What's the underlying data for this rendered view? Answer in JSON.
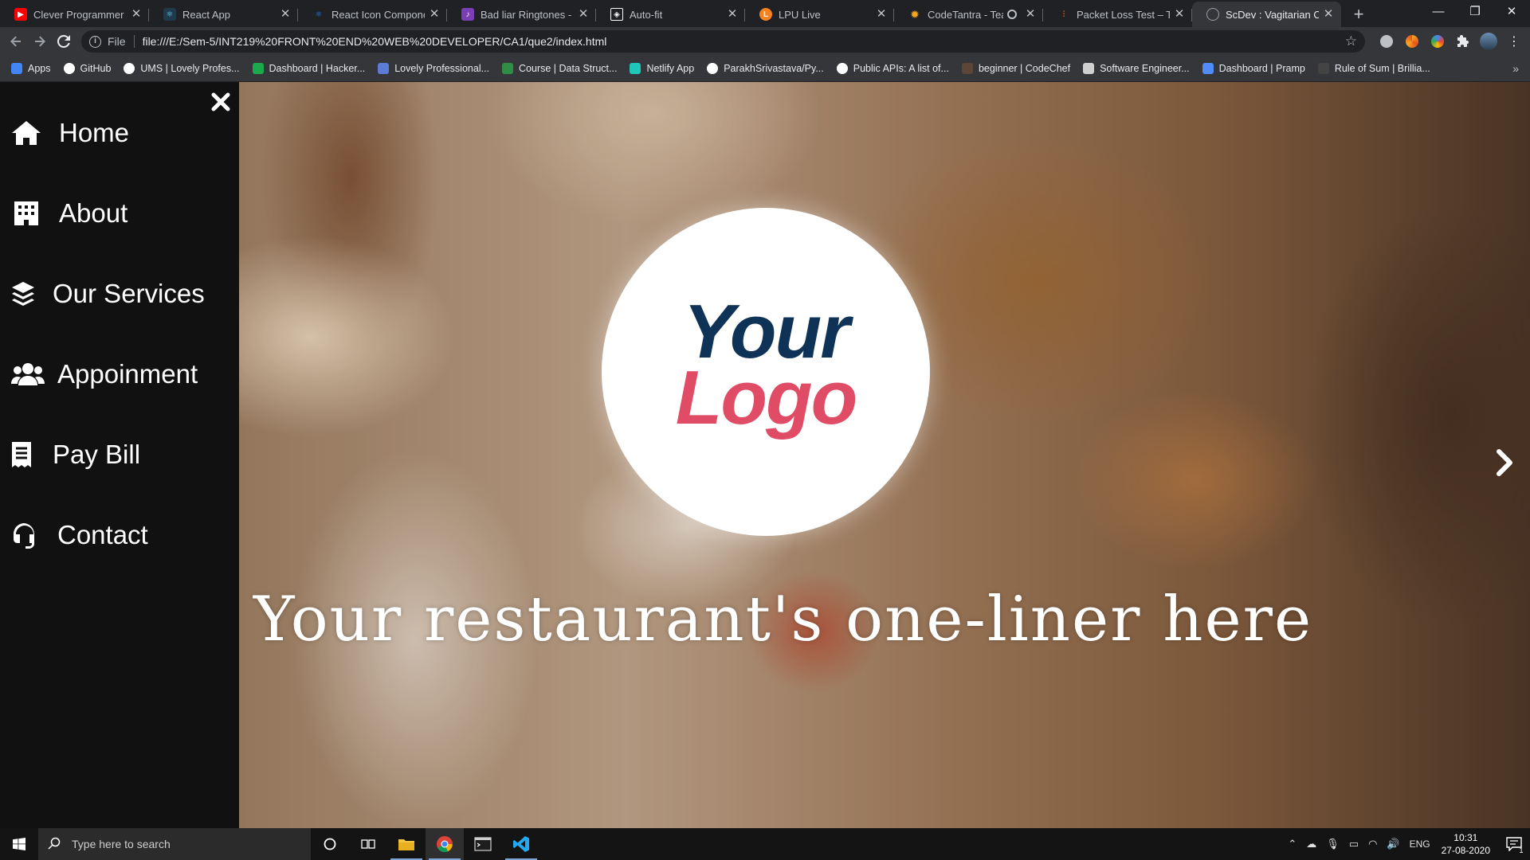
{
  "browser": {
    "tabs": [
      {
        "title": "Clever Programmer - Yo",
        "icon": "youtube-icon",
        "color": "#ff0000"
      },
      {
        "title": "React App",
        "icon": "react-icon",
        "color": "#61dafb"
      },
      {
        "title": "React Icon Component",
        "icon": "react-icons-icon",
        "color": "#2f80ed"
      },
      {
        "title": "Bad liar Ringtones - Fre",
        "icon": "ringtone-icon",
        "color": "#7b3fb5"
      },
      {
        "title": "Auto-fit",
        "icon": "codepen-icon",
        "color": "#ffffff"
      },
      {
        "title": "LPU Live",
        "icon": "lpu-icon",
        "color": "#f58220"
      },
      {
        "title": "CodeTantra - Teach",
        "icon": "codetantra-icon",
        "color": "#f5a623"
      },
      {
        "title": "Packet Loss Test – Test",
        "icon": "packet-loss-icon",
        "color": "#e8501c"
      },
      {
        "title": "ScDev : Vagitarian Caffe",
        "icon": "globe-icon",
        "color": "#9aa0a6"
      }
    ],
    "active_tab_index": 8,
    "address": {
      "scheme": "File",
      "url": "file:///E:/Sem-5/INT219%20FRONT%20END%20WEB%20DEVELOPER/CA1/que2/index.html"
    },
    "bookmarks": [
      {
        "label": "Apps",
        "color": "#4285f4"
      },
      {
        "label": "GitHub",
        "color": "#ffffff"
      },
      {
        "label": "UMS | Lovely Profes...",
        "color": "#ffffff"
      },
      {
        "label": "Dashboard | Hacker...",
        "color": "#1ba94c"
      },
      {
        "label": "Lovely Professional...",
        "color": "#5b7bd5"
      },
      {
        "label": "Course | Data Struct...",
        "color": "#2f8d46"
      },
      {
        "label": "Netlify App",
        "color": "#20c6b7"
      },
      {
        "label": "ParakhSrivastava/Py...",
        "color": "#ffffff"
      },
      {
        "label": "Public APIs: A list of...",
        "color": "#ffffff"
      },
      {
        "label": "beginner | CodeChef",
        "color": "#5b4638"
      },
      {
        "label": "Software Engineer...",
        "color": "#cfcfcf"
      },
      {
        "label": "Dashboard | Pramp",
        "color": "#4f8cf7"
      },
      {
        "label": "Rule of Sum | Brillia...",
        "color": "#444444"
      }
    ]
  },
  "site": {
    "sidebar": {
      "items": [
        {
          "label": "Home",
          "icon": "home-icon"
        },
        {
          "label": "About",
          "icon": "building-icon"
        },
        {
          "label": "Our Services",
          "icon": "layers-icon"
        },
        {
          "label": "Appoinment",
          "icon": "users-icon"
        },
        {
          "label": "Pay Bill",
          "icon": "receipt-icon"
        },
        {
          "label": "Contact",
          "icon": "headset-icon"
        }
      ]
    },
    "hero": {
      "logo_line1": "Your",
      "logo_line2": "Logo",
      "tagline": "Your restaurant's one-liner here"
    },
    "colors": {
      "logo_navy": "#0f3257",
      "logo_pink": "#e04c66",
      "sidebar_bg": "#111111"
    }
  },
  "taskbar": {
    "search_placeholder": "Type here to search",
    "language": "ENG",
    "time": "10:31",
    "date": "27-08-2020",
    "notification_count": "1"
  }
}
